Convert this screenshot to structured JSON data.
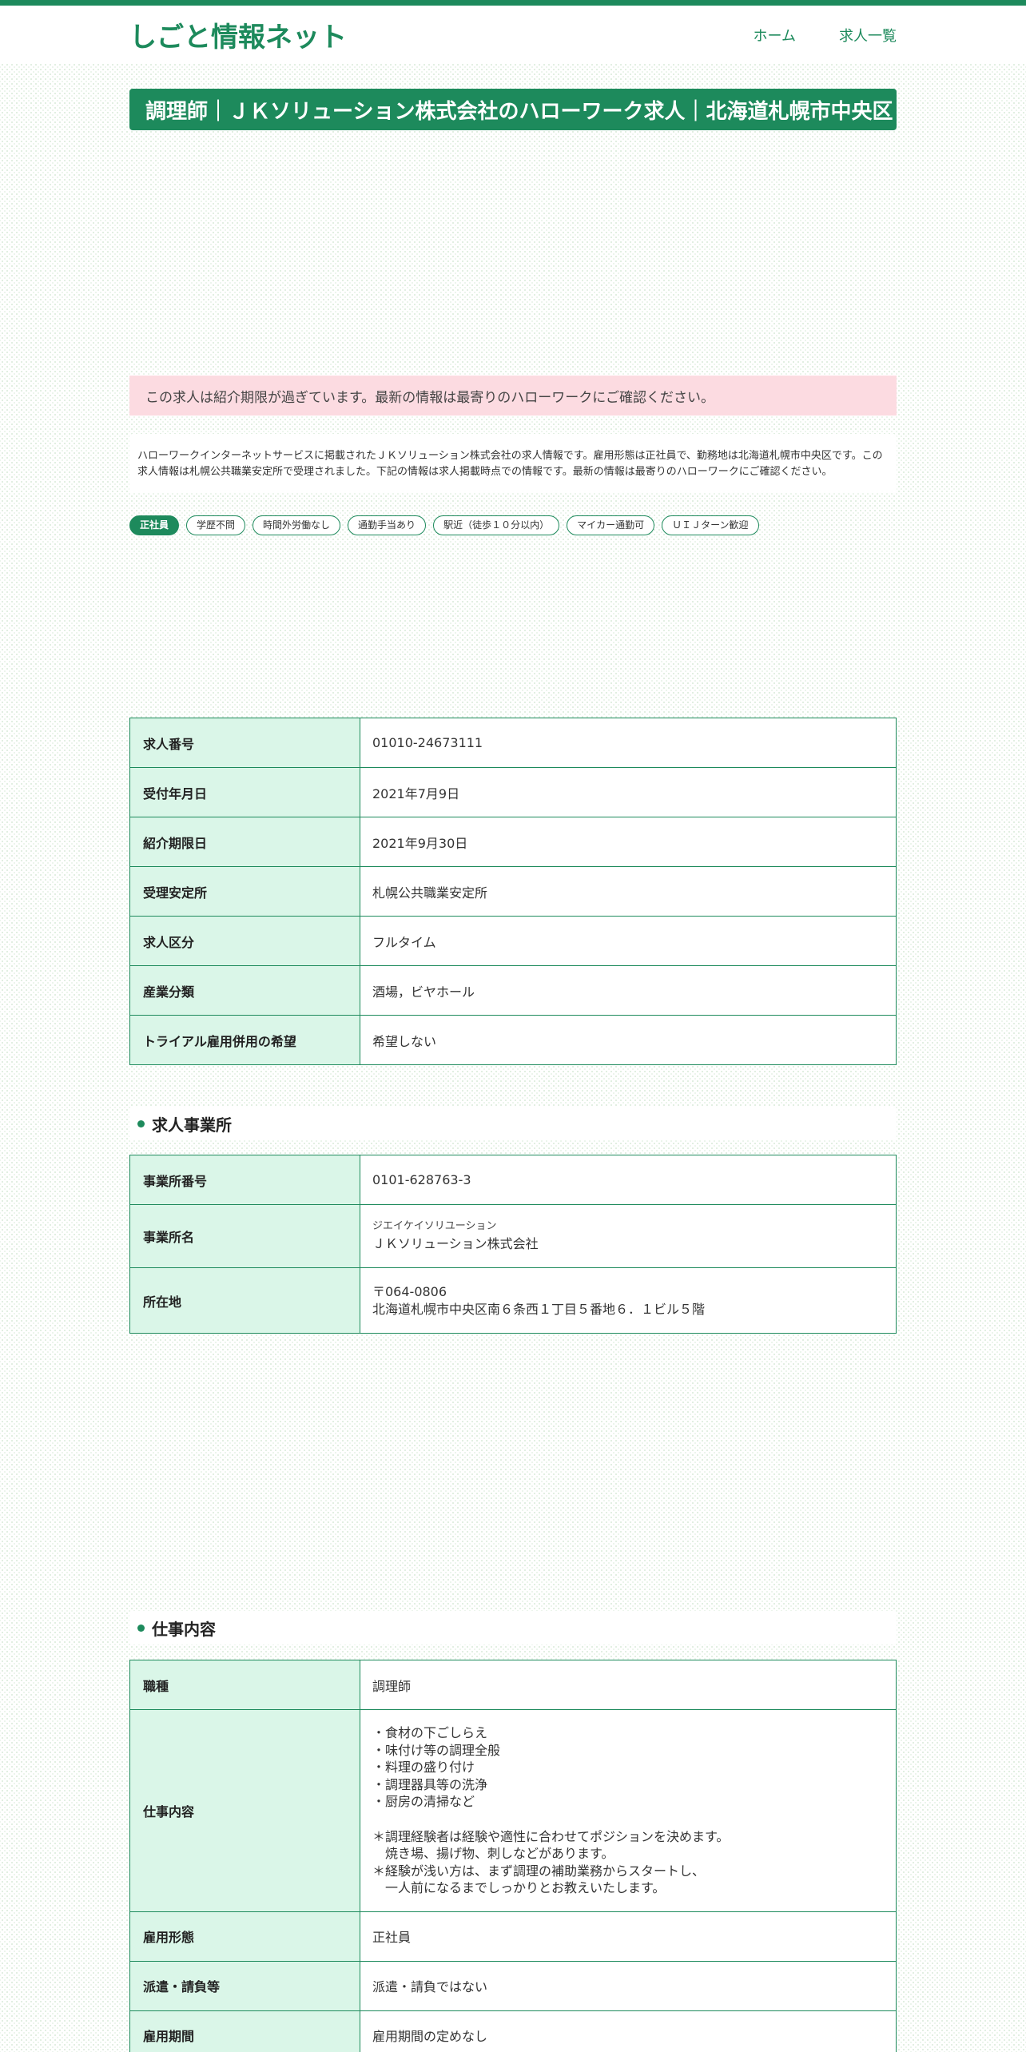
{
  "site": {
    "logo": "しごと情報ネット",
    "nav": [
      "ホーム",
      "求人一覧"
    ]
  },
  "page_title": "調理師｜ＪＫソリューション株式会社のハローワーク求人｜北海道札幌市中央区",
  "alert_text": "この求人は紹介期限が過ぎています。最新の情報は最寄りのハローワークにご確認ください。",
  "description": "ハローワークインターネットサービスに掲載されたＪＫソリューション株式会社の求人情報です。雇用形態は正社員で、勤務地は北海道札幌市中央区です。この求人情報は札幌公共職業安定所で受理されました。下記の情報は求人掲載時点での情報です。最新の情報は最寄りのハローワークにご確認ください。",
  "tags": [
    "正社員",
    "学歴不問",
    "時間外労働なし",
    "通勤手当あり",
    "駅近（徒歩１０分以内）",
    "マイカー通勤可",
    "ＵＩＪターン歓迎"
  ],
  "basic_info": [
    {
      "label": "求人番号",
      "value": "01010-24673111"
    },
    {
      "label": "受付年月日",
      "value": "2021年7月9日"
    },
    {
      "label": "紹介期限日",
      "value": "2021年9月30日"
    },
    {
      "label": "受理安定所",
      "value": "札幌公共職業安定所"
    },
    {
      "label": "求人区分",
      "value": "フルタイム"
    },
    {
      "label": "産業分類",
      "value": "酒場，ビヤホール"
    },
    {
      "label": "トライアル雇用併用の希望",
      "value": "希望しない"
    }
  ],
  "office_section": {
    "title": "求人事業所",
    "office_no_label": "事業所番号",
    "office_no": "0101-628763-3",
    "name_label": "事業所名",
    "name_kana": "ジエイケイソリユーション",
    "name": "ＪＫソリューション株式会社",
    "address_label": "所在地",
    "postal": "〒064-0806",
    "address": "北海道札幌市中央区南６条西１丁目５番地６．１ビル５階"
  },
  "job_section": {
    "title": "仕事内容",
    "occupation_label": "職種",
    "occupation": "調理師",
    "content_label": "仕事内容",
    "content": "・食材の下ごしらえ\n・味付け等の調理全般\n・料理の盛り付け\n・調理器具等の洗浄\n・厨房の清掃など\n\n＊調理経験者は経験や適性に合わせてポジションを決めます。\n　焼き場、揚げ物、刺しなどがあります。\n＊経験が浅い方は、まず調理の補助業務からスタートし、\n　一人前になるまでしっかりとお教えいたします。",
    "employment_label": "雇用形態",
    "employment": "正社員",
    "dispatch_label": "派遣・請負等",
    "dispatch": "派遣・請負ではない",
    "period_label": "雇用期間",
    "period": "雇用期間の定めなし"
  },
  "colors": {
    "brand": "#1d8a5c",
    "label_bg": "#daf6e8",
    "alert_bg": "#fcdbe1"
  }
}
